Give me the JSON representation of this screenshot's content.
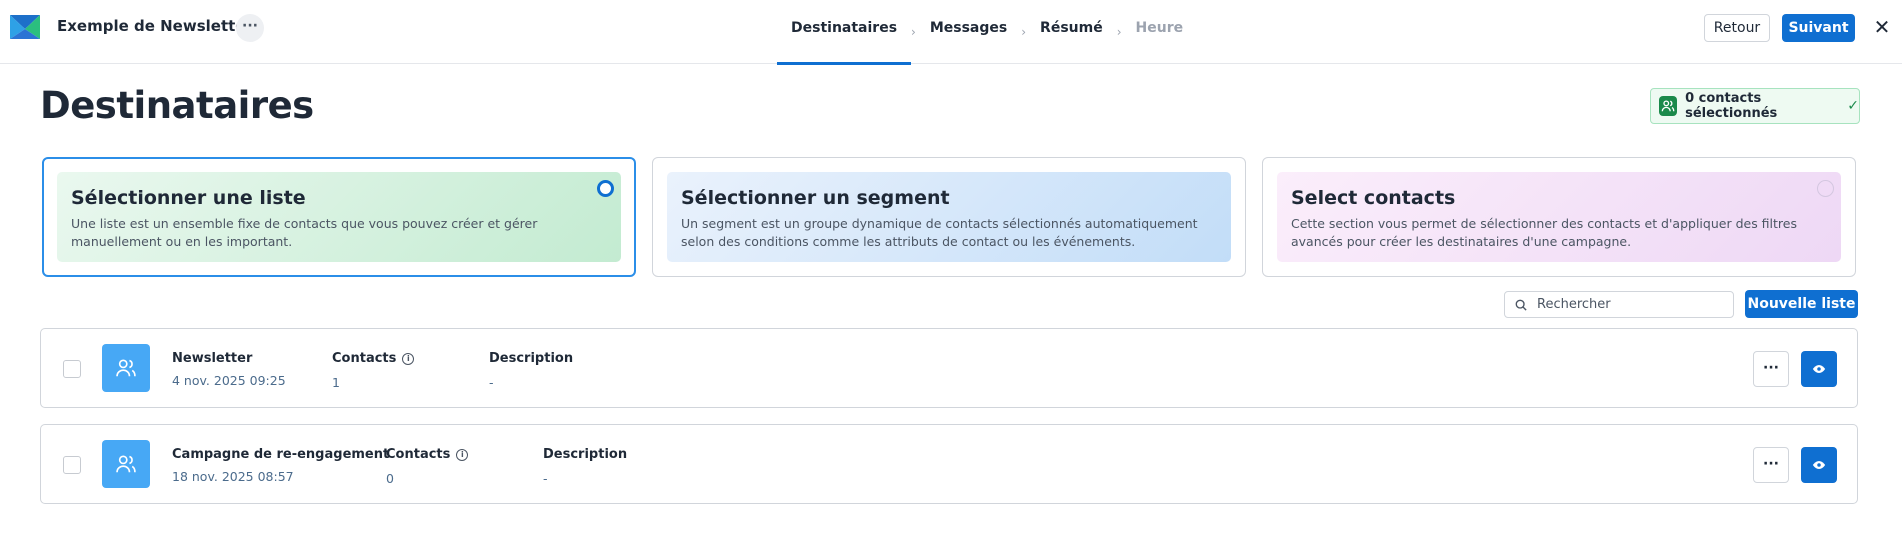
{
  "header": {
    "app_title": "Exemple de Newsletter",
    "more_label": "···",
    "steps": [
      {
        "label": "Destinataires",
        "state": "active"
      },
      {
        "label": "Messages",
        "state": "done"
      },
      {
        "label": "Résumé",
        "state": "done"
      },
      {
        "label": "Heure",
        "state": "disabled"
      }
    ],
    "step_separator": "›",
    "back_label": "Retour",
    "next_label": "Suivant",
    "close_label": "✕"
  },
  "page": {
    "title": "Destinataires",
    "selected_badge": "0 contacts sélectionnés",
    "badge_check": "✓"
  },
  "options": [
    {
      "title": "Sélectionner une liste",
      "description": "Une liste est un ensemble fixe de contacts que vous pouvez créer et gérer manuellement ou en les important.",
      "selected": true
    },
    {
      "title": "Sélectionner un segment",
      "description": "Un segment est un groupe dynamique de contacts sélectionnés automatiquement selon des conditions comme les attributs de contact ou les événements.",
      "selected": false
    },
    {
      "title": "Select contacts",
      "description": "Cette section vous permet de sélectionner des contacts et d'appliquer des filtres avancés pour créer les destinataires d'une campagne.",
      "selected": false
    }
  ],
  "toolbar": {
    "search_placeholder": "Rechercher",
    "new_list_label": "Nouvelle liste"
  },
  "lists": [
    {
      "name": "Newsletter",
      "date": "4 nov. 2025 09:25",
      "contacts_header": "Contacts",
      "contacts": "1",
      "description_header": "Description",
      "description": "-"
    },
    {
      "name": "Campagne de re-engagement",
      "date": "18 nov. 2025 08:57",
      "contacts_header": "Contacts",
      "contacts": "0",
      "description_header": "Description",
      "description": "-"
    }
  ],
  "row_more_label": "···",
  "colors": {
    "accent": "#0f6fd1",
    "success": "#1b8a4b",
    "avatar": "#47a8f5"
  }
}
